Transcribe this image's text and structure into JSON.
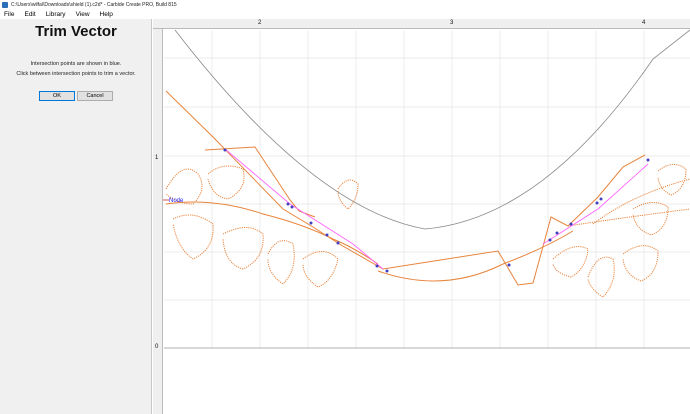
{
  "window": {
    "title": "C:\\Users\\wilfal\\Downloads\\shield (1).c2d* - Carbide Create PRO, Build 815"
  },
  "menu": [
    "File",
    "Edit",
    "Library",
    "View",
    "Help"
  ],
  "panel": {
    "title": "Trim Vector",
    "line1": "Intersection points are shown in blue.",
    "line2": "Click between intersection points to trim a vector.",
    "ok_label": "OK",
    "cancel_label": "Cancel"
  },
  "ruler": {
    "top": [
      "2",
      "3",
      "4"
    ],
    "left": [
      "1",
      "0"
    ]
  },
  "canvas": {
    "node_label": "Node",
    "colors": {
      "vector": "#e8843c",
      "arc": "#888888",
      "selected": "#ff66ff",
      "intersection": "#4040c0",
      "node": "#1a1aff",
      "grid": "#e4e4e4"
    }
  }
}
